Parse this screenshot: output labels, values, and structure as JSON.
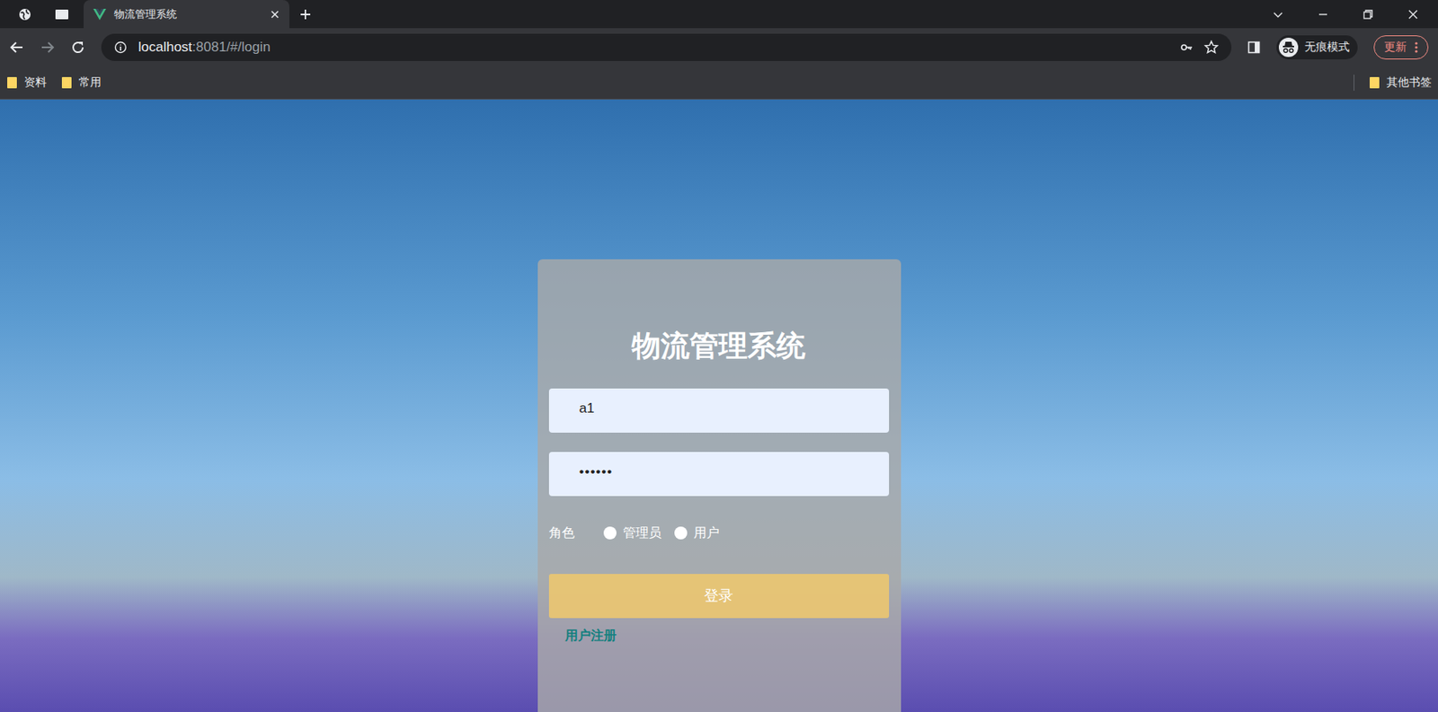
{
  "browser": {
    "tabs": [
      {
        "title": "物流管理系统",
        "selected": true
      }
    ],
    "url_host": "localhost",
    "url_rest": ":8081/#/login",
    "profile": "无痕模式",
    "update": "更新",
    "bookmarks": [
      "资料",
      "常用"
    ],
    "other_bookmarks": "其他书签"
  },
  "login": {
    "title": "物流管理系统",
    "username": "a1",
    "password": "••••••",
    "role_label": "角色",
    "roles": [
      {
        "label": "管理员",
        "selected": false
      },
      {
        "label": "用户",
        "selected": false
      }
    ],
    "submit": "登录",
    "register": "用户注册"
  }
}
